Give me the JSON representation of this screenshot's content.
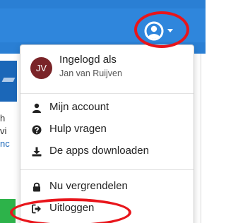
{
  "header": {
    "user_icon": "user-circle-icon",
    "caret_icon": "caret-down-icon",
    "background_color": "#2a7fd4"
  },
  "background": {
    "text_lines": [
      "h",
      "vi",
      "nc"
    ]
  },
  "dropdown": {
    "logged_in_label": "Ingelogd als",
    "user_name": "Jan van Ruijven",
    "avatar_initials": "JV",
    "avatar_color": "#7a2428",
    "items": [
      {
        "label": "Mijn account",
        "icon": "user-icon"
      },
      {
        "label": "Hulp vragen",
        "icon": "question-circle-icon"
      },
      {
        "label": "De apps downloaden",
        "icon": "download-icon"
      },
      {
        "label": "Nu vergrendelen",
        "icon": "lock-icon"
      },
      {
        "label": "Uitloggen",
        "icon": "sign-out-icon"
      }
    ]
  },
  "annotations": {
    "color": "#e8151b"
  }
}
